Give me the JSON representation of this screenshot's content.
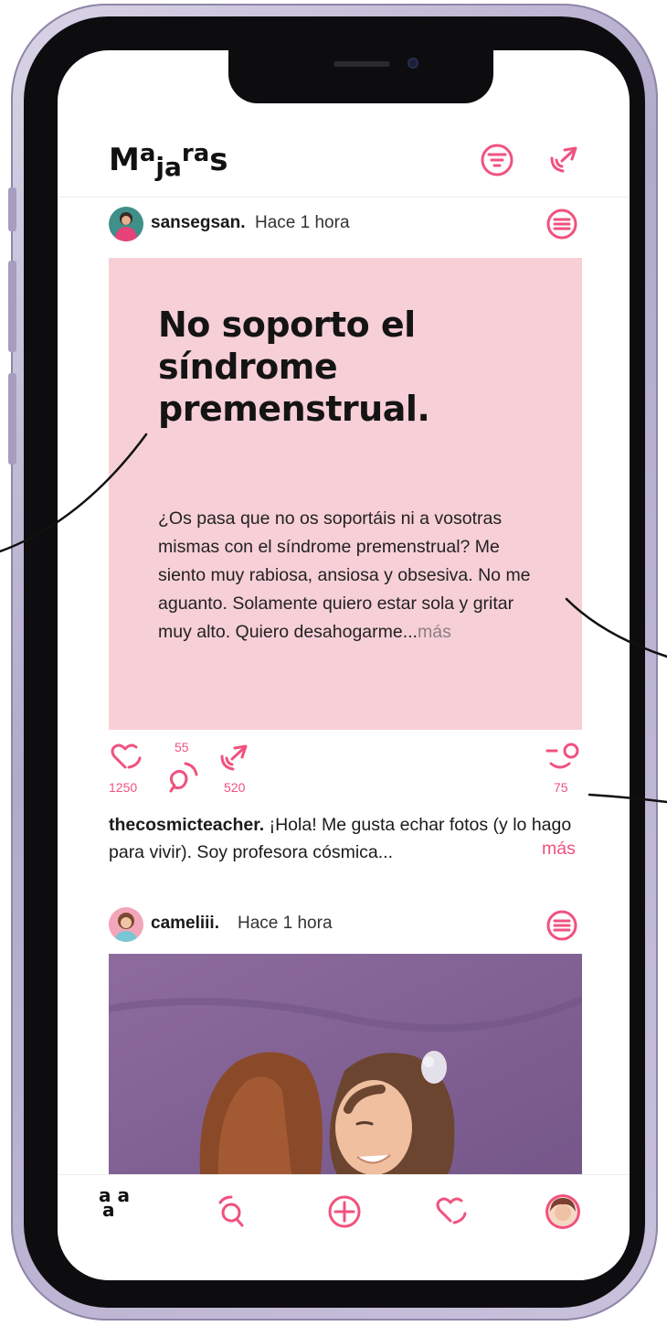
{
  "app": {
    "logo_letters": [
      "M",
      "a",
      "j",
      "a",
      "r",
      "a",
      "s"
    ]
  },
  "header": {
    "icons": [
      "filter-icon",
      "send-icon"
    ]
  },
  "post1": {
    "username": "sansegsan",
    "separator": ".",
    "time": "Hace 1 hora",
    "title": "No soporto el síndrome premenstrual.",
    "body": "¿Os pasa que no os soportáis ni a vosotras mismas con el síndrome premenstrual? Me siento muy rabiosa, ansiosa y obsesiva. No me aguanto. Solamente quiero estar sola y gritar muy alto. Quiero desahogarme...",
    "more": "más",
    "likes": "1250",
    "comments": "55",
    "shares": "520",
    "reactions": "75"
  },
  "caption": {
    "username": "thecosmicteacher",
    "separator": ".",
    "text": "¡Hola! Me gusta echar fotos (y lo hago para vivir). Soy profesora cósmica...",
    "more": "más"
  },
  "post2": {
    "username": "cameliii",
    "separator": ".",
    "time": "Hace 1 hora"
  },
  "nav": {
    "home_glyph_top": "a a",
    "home_glyph_bottom": "a",
    "items": [
      "home-icon",
      "search-icon",
      "add-icon",
      "heart-icon",
      "profile-avatar"
    ]
  },
  "colors": {
    "accent": "#f0527e",
    "card_bg": "#f7cfd6",
    "photo_bg": "#8a6a9a"
  }
}
